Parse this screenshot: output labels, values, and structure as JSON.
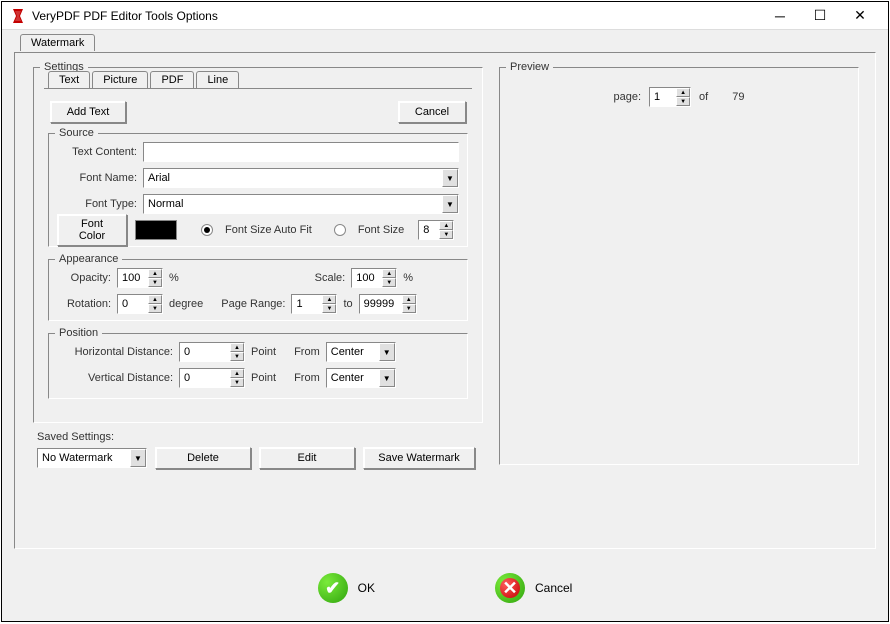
{
  "window": {
    "title": "VeryPDF PDF Editor Tools Options"
  },
  "mainTab": "Watermark",
  "settings": {
    "legend": "Settings",
    "tabs": [
      "Text",
      "Picture",
      "PDF",
      "Line"
    ],
    "activeTab": "Text",
    "addText": "Add Text",
    "cancel": "Cancel"
  },
  "source": {
    "legend": "Source",
    "textContentLabel": "Text Content:",
    "textContent": "",
    "fontNameLabel": "Font Name:",
    "fontName": "Arial",
    "fontTypeLabel": "Font Type:",
    "fontType": "Normal",
    "fontColorLabel": "Font Color",
    "fontColor": "#000000",
    "fontSizeAutoFitLabel": "Font Size Auto Fit",
    "fontSizeLabel": "Font Size",
    "fontSize": "8",
    "fontSizeMode": "auto"
  },
  "appearance": {
    "legend": "Appearance",
    "opacityLabel": "Opacity:",
    "opacity": "100",
    "opacityUnit": "%",
    "scaleLabel": "Scale:",
    "scale": "100",
    "scaleUnit": "%",
    "rotationLabel": "Rotation:",
    "rotation": "0",
    "rotationUnit": "degree",
    "pageRangeLabel": "Page Range:",
    "pageFrom": "1",
    "toLabel": "to",
    "pageTo": "99999"
  },
  "position": {
    "legend": "Position",
    "hDistLabel": "Horizontal Distance:",
    "hDist": "0",
    "vDistLabel": "Vertical Distance:",
    "vDist": "0",
    "pointLabel": "Point",
    "fromLabel": "From",
    "hFrom": "Center",
    "vFrom": "Center"
  },
  "saved": {
    "label": "Saved Settings:",
    "current": "No Watermark",
    "delete": "Delete",
    "edit": "Edit",
    "save": "Save Watermark"
  },
  "preview": {
    "legend": "Preview",
    "pageLabel": "page:",
    "page": "1",
    "ofLabel": "of",
    "total": "79"
  },
  "footer": {
    "ok": "OK",
    "cancel": "Cancel"
  }
}
